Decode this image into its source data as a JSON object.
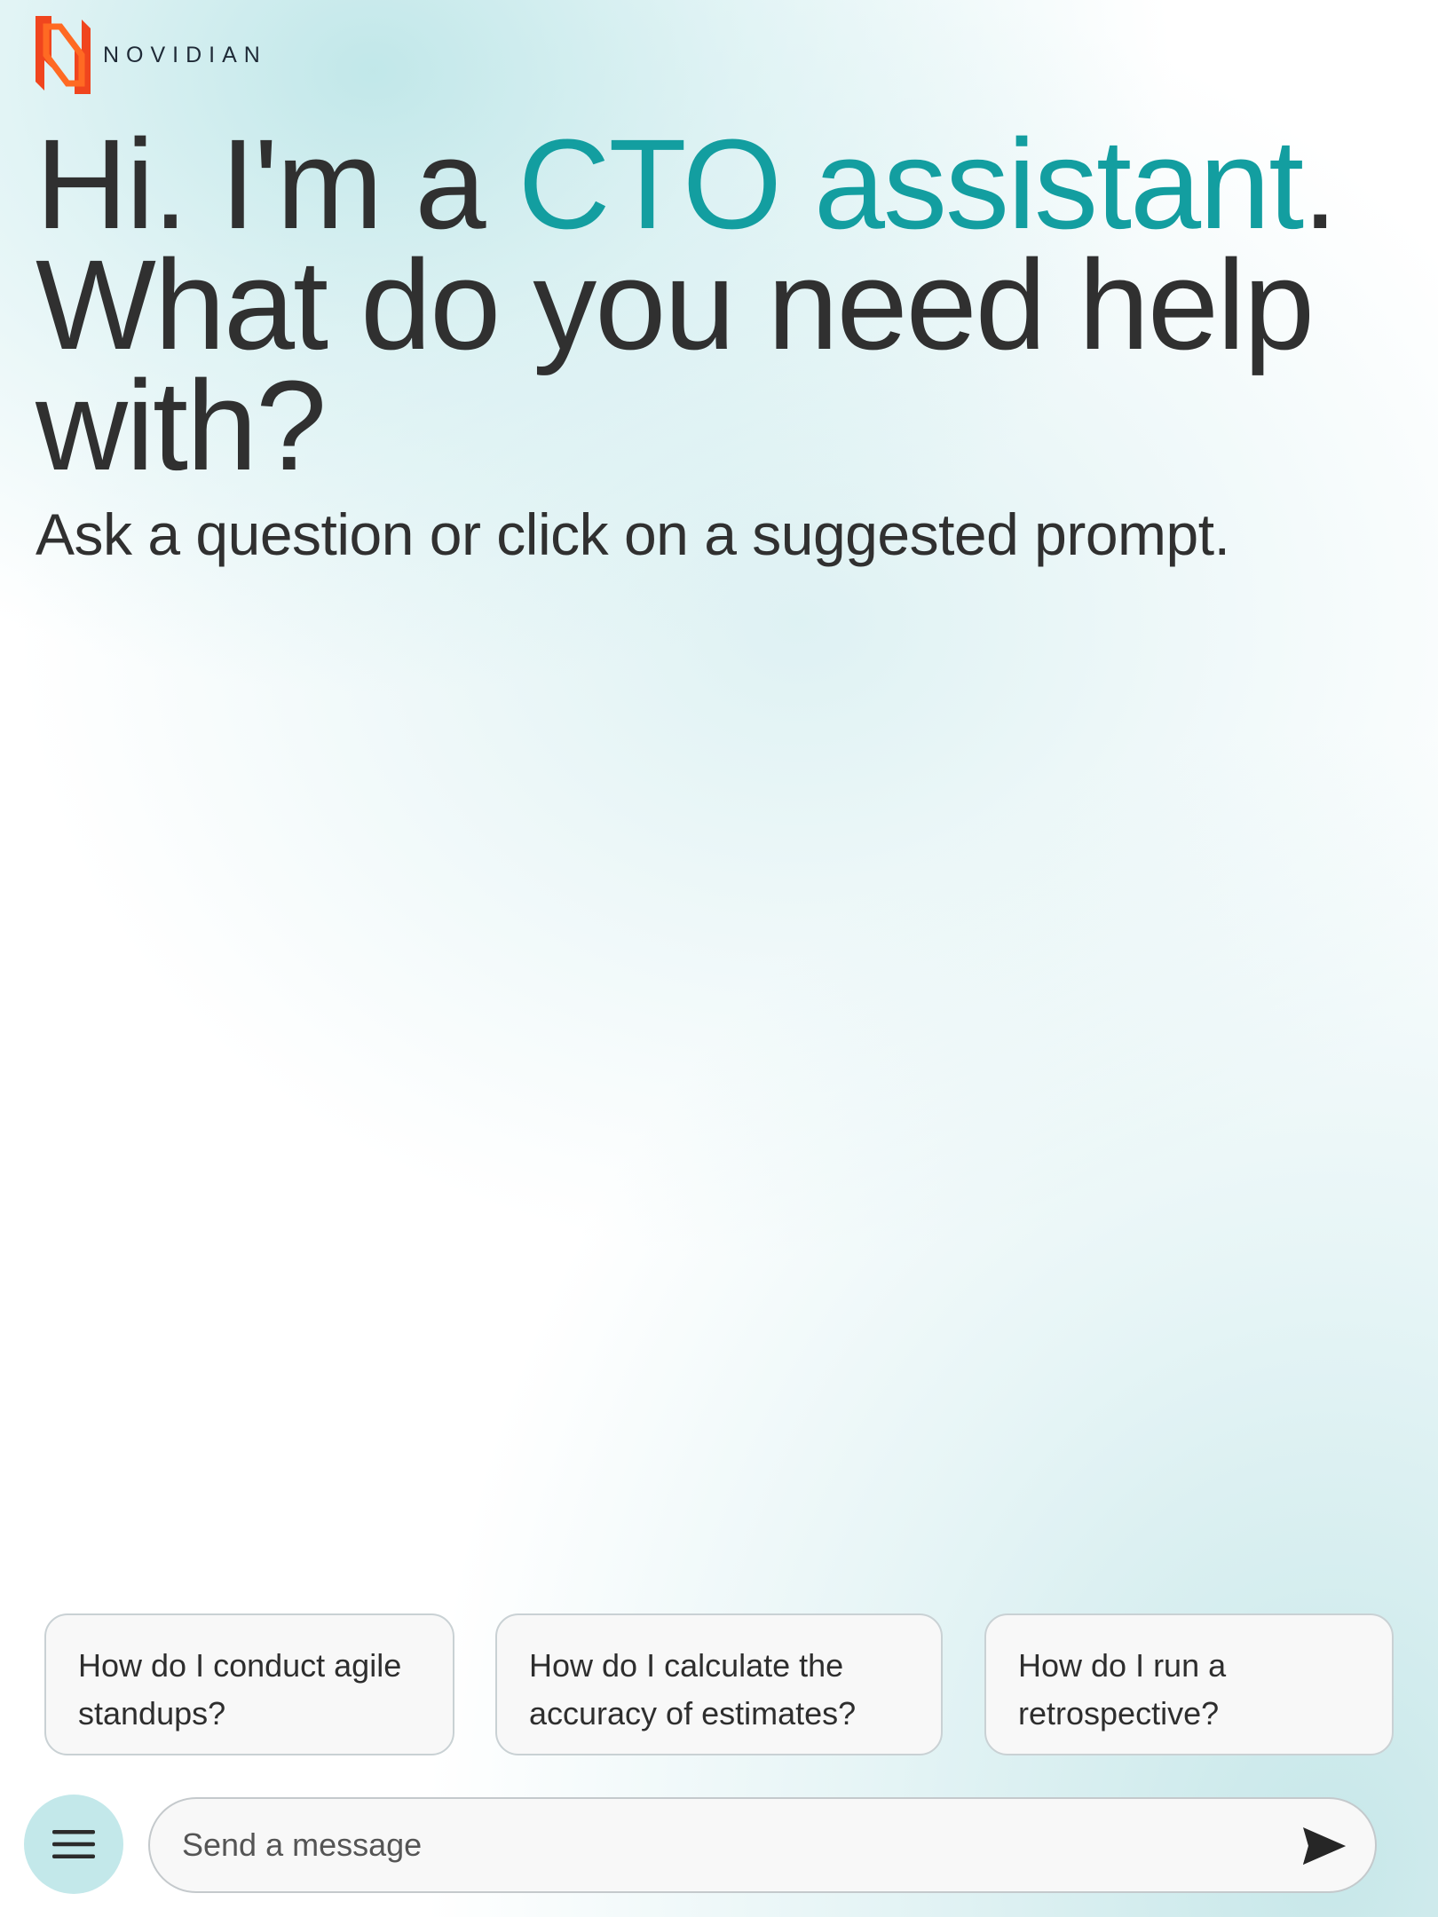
{
  "brand": {
    "name": "NOVIDIAN",
    "logo_icon": "novidian-logo-icon",
    "logo_colors": [
      "#f0451e",
      "#ff7a2a"
    ]
  },
  "hero": {
    "title_prefix": "Hi. I'm a ",
    "title_accent": "CTO assistant",
    "title_suffix": ".",
    "title_line2": "What do you need help with?",
    "subtitle": "Ask a question or click on a suggested prompt.",
    "accent_color": "#139ea0"
  },
  "prompts": [
    {
      "label": "How do I conduct agile standups?"
    },
    {
      "label": "How do I calculate the accuracy of estimates?"
    },
    {
      "label": "How do I run a retrospective?"
    }
  ],
  "composer": {
    "placeholder": "Send a message",
    "value": "",
    "menu_icon": "hamburger-menu-icon",
    "send_icon": "send-arrow-icon"
  }
}
